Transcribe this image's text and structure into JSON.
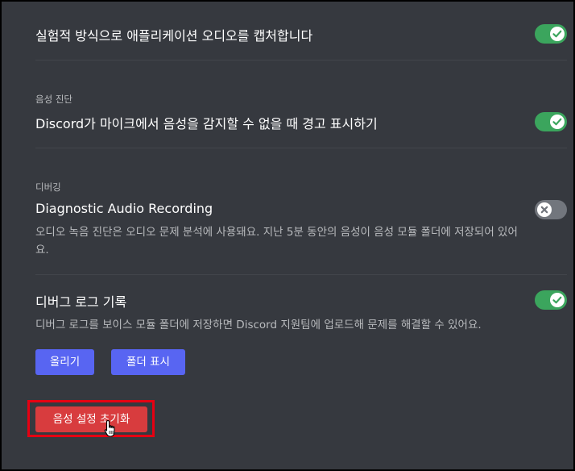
{
  "settings": {
    "capture_audio": {
      "title": "실험적 방식으로 애플리케이션 오디오를 캡처합니다",
      "enabled": true
    },
    "voice_diagnostics": {
      "section_label": "음성 진단",
      "title": "Discord가 마이크에서 음성을 감지할 수 없을 때 경고 표시하기",
      "enabled": true
    },
    "debugging": {
      "section_label": "디버깅",
      "title": "Diagnostic Audio Recording",
      "description_line1": "오디오 녹음 진단은 오디오 문제 분석에 사용돼요. 지난 5분 동안의 음성이 음성 모듈 폴더에 저장되어 있어",
      "description_line2": "요.",
      "enabled": false
    },
    "debug_log": {
      "title": "디버그 로그 기록",
      "description": "디버그 로그를 보이스 모듈 폴더에 저장하면 Discord 지원팀에 업로드해 문제를 해결할 수 있어요.",
      "enabled": true,
      "upload_label": "올리기",
      "show_folder_label": "폴더 표시"
    },
    "reset_label": "음성 설정 초기화"
  },
  "colors": {
    "background": "#36393f",
    "toggle_on": "#3ba55d",
    "toggle_off": "#72767d",
    "blurple": "#5865f2",
    "danger": "#d83c3e",
    "highlight": "#e60012"
  },
  "icons": {
    "check": "check-icon",
    "x": "x-icon",
    "cursor": "hand-cursor-icon"
  }
}
